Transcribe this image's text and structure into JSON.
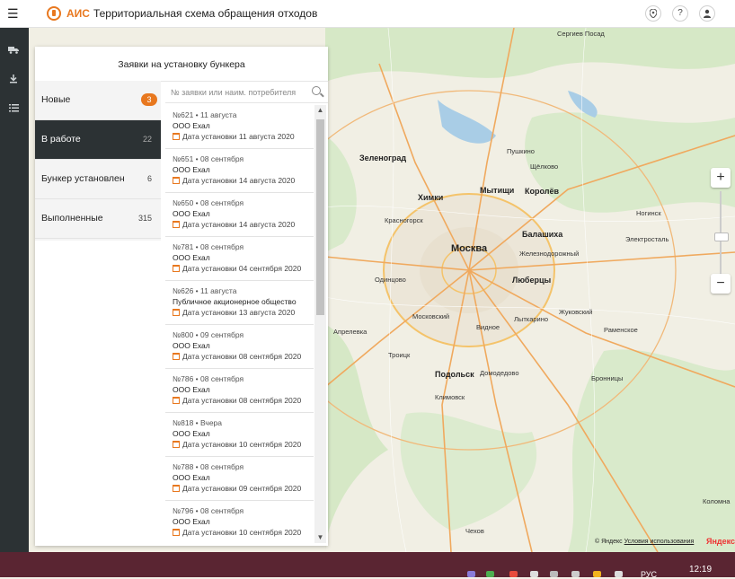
{
  "header": {
    "app_abbr": "АИС",
    "app_title": "Территориальная схема обращения отходов",
    "icons": [
      "location-icon",
      "help-icon",
      "user-icon"
    ],
    "help_glyph": "?"
  },
  "sidebar": {
    "icons": [
      "truck-icon",
      "download-icon",
      "list-icon"
    ]
  },
  "panel": {
    "title": "Заявки на установку бункера",
    "statuses": [
      {
        "label": "Новые",
        "count": "3",
        "badge": true
      },
      {
        "label": "В работе",
        "count": "22",
        "active": true
      },
      {
        "label": "Бункер установлен",
        "count": "6"
      },
      {
        "label": "Выполненные",
        "count": "315"
      }
    ],
    "search_placeholder": "№ заявки или наим. потребителя",
    "requests": [
      {
        "head": "№621 • 11 августа",
        "org": "ООО Ехал",
        "date": "Дата установки 11 августа 2020"
      },
      {
        "head": "№651 • 08 сентября",
        "org": "ООО Ехал",
        "date": "Дата установки 14 августа 2020"
      },
      {
        "head": "№650 • 08 сентября",
        "org": "ООО Ехал",
        "date": "Дата установки 14 августа 2020"
      },
      {
        "head": "№781 • 08 сентября",
        "org": "ООО Ехал",
        "date": "Дата установки 04 сентября 2020"
      },
      {
        "head": "№626 • 11 августа",
        "org": "Публичное акционерное общество",
        "date": "Дата установки 13 августа 2020"
      },
      {
        "head": "№800 • 09 сентября",
        "org": "ООО Ехал",
        "date": "Дата установки 08 сентября 2020"
      },
      {
        "head": "№786 • 08 сентября",
        "org": "ООО Ехал",
        "date": "Дата установки 08 сентября 2020"
      },
      {
        "head": "№818 • Вчера",
        "org": "ООО Ехал",
        "date": "Дата установки 10 сентября 2020"
      },
      {
        "head": "№788 • 08 сентября",
        "org": "ООО Ехал",
        "date": "Дата установки 09 сентября 2020"
      },
      {
        "head": "№796 • 08 сентября",
        "org": "ООО Ехал",
        "date": "Дата установки 10 сентября 2020"
      }
    ]
  },
  "map": {
    "zoom_in": "+",
    "zoom_out": "−",
    "copyright": "© Яндекс",
    "terms_link": "Условия использования",
    "provider": "Яндекс",
    "labels": [
      {
        "text": "Москва",
        "big": true
      },
      {
        "text": "Зеленоград",
        "big": true
      },
      {
        "text": "Химки",
        "big": true
      },
      {
        "text": "Мытищи",
        "big": true
      },
      {
        "text": "Королёв",
        "big": true
      },
      {
        "text": "Балашиха",
        "big": true
      },
      {
        "text": "Люберцы",
        "big": true
      },
      {
        "text": "Одинцово",
        "big": false
      },
      {
        "text": "Подольск",
        "big": true
      },
      {
        "text": "Домодедово",
        "big": false
      },
      {
        "text": "Красногорск",
        "big": false
      },
      {
        "text": "Ногинск",
        "big": false
      },
      {
        "text": "Электросталь",
        "big": false
      },
      {
        "text": "Жуковский",
        "big": false
      },
      {
        "text": "Раменское",
        "big": false
      },
      {
        "text": "Пушкино",
        "big": false
      },
      {
        "text": "Сергиев Посад",
        "big": false
      },
      {
        "text": "Видное",
        "big": false
      },
      {
        "text": "Щёлково",
        "big": false
      },
      {
        "text": "Лыткарино",
        "big": false
      },
      {
        "text": "Климовск",
        "big": false
      },
      {
        "text": "Троицк",
        "big": false
      },
      {
        "text": "Апрелевка",
        "big": false
      },
      {
        "text": "Московский",
        "big": false
      },
      {
        "text": "Железнодорожный",
        "big": false
      },
      {
        "text": "Бронницы",
        "big": false
      },
      {
        "text": "Чехов",
        "big": false
      },
      {
        "text": "Коломна",
        "big": false
      }
    ]
  },
  "taskbar": {
    "lang": "РУС",
    "time": "12:19"
  }
}
